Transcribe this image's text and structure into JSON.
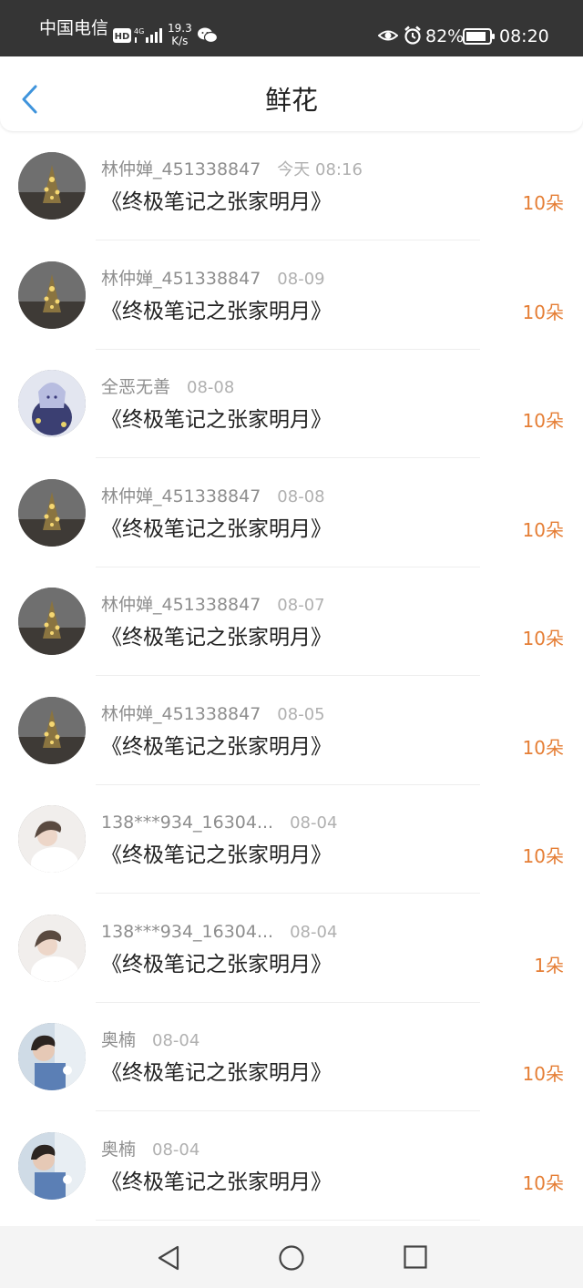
{
  "status_bar": {
    "carrier": "中国电信",
    "hd": "HD",
    "network": "4G",
    "speed_value": "19.3",
    "speed_unit": "K/s",
    "battery": "82%",
    "time": "08:20"
  },
  "header": {
    "title": "鲜花"
  },
  "rows": [
    {
      "user": "林仲婵_451338847",
      "date": "今天 08:16",
      "book": "《终极笔记之张家明月》",
      "amount": "10朵",
      "avatar": "A"
    },
    {
      "user": "林仲婵_451338847",
      "date": "08-09",
      "book": "《终极笔记之张家明月》",
      "amount": "10朵",
      "avatar": "A"
    },
    {
      "user": "全恶无善",
      "date": "08-08",
      "book": "《终极笔记之张家明月》",
      "amount": "10朵",
      "avatar": "B"
    },
    {
      "user": "林仲婵_451338847",
      "date": "08-08",
      "book": "《终极笔记之张家明月》",
      "amount": "10朵",
      "avatar": "A"
    },
    {
      "user": "林仲婵_451338847",
      "date": "08-07",
      "book": "《终极笔记之张家明月》",
      "amount": "10朵",
      "avatar": "A"
    },
    {
      "user": "林仲婵_451338847",
      "date": "08-05",
      "book": "《终极笔记之张家明月》",
      "amount": "10朵",
      "avatar": "A"
    },
    {
      "user": "138***934_16304...",
      "date": "08-04",
      "book": "《终极笔记之张家明月》",
      "amount": "10朵",
      "avatar": "C"
    },
    {
      "user": "138***934_16304...",
      "date": "08-04",
      "book": "《终极笔记之张家明月》",
      "amount": "1朵",
      "avatar": "C"
    },
    {
      "user": "奥楠",
      "date": "08-04",
      "book": "《终极笔记之张家明月》",
      "amount": "10朵",
      "avatar": "D"
    },
    {
      "user": "奥楠",
      "date": "08-04",
      "book": "《终极笔记之张家明月》",
      "amount": "10朵",
      "avatar": "D"
    }
  ],
  "colors": {
    "accent": "#3f94dc",
    "amount": "#e57e35",
    "status_bar": "#353535",
    "nav_bar": "#f4f4f4"
  }
}
